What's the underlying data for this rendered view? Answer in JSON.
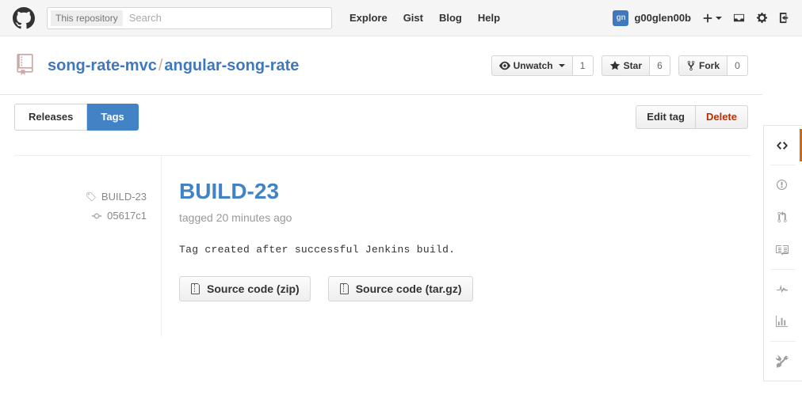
{
  "header": {
    "logo_icon": "github-mark-icon",
    "search": {
      "context_label": "This repository",
      "placeholder": "Search",
      "value": ""
    },
    "nav": [
      {
        "label": "Explore",
        "name": "explore"
      },
      {
        "label": "Gist",
        "name": "gist"
      },
      {
        "label": "Blog",
        "name": "blog"
      },
      {
        "label": "Help",
        "name": "help"
      }
    ],
    "user": {
      "username": "g00glen00b",
      "avatar_initials": "gn",
      "avatar_color": "#4078c0"
    },
    "icons": [
      {
        "name": "create-new-icon",
        "glyph": "+"
      },
      {
        "name": "inbox-icon",
        "glyph": "inbox"
      },
      {
        "name": "gear-icon",
        "glyph": "gear"
      },
      {
        "name": "sign-out-icon",
        "glyph": "sign-out"
      }
    ]
  },
  "repo": {
    "icon": "repo-book-icon",
    "owner": "song-rate-mvc",
    "separator": "/",
    "name": "angular-song-rate",
    "actions": [
      {
        "name": "unwatch",
        "icon": "eye-icon",
        "label": "Unwatch",
        "has_caret": true,
        "count": "1"
      },
      {
        "name": "star",
        "icon": "star-icon",
        "label": "Star",
        "has_caret": false,
        "count": "6"
      },
      {
        "name": "fork",
        "icon": "repo-forked-icon",
        "label": "Fork",
        "has_caret": false,
        "count": "0"
      }
    ]
  },
  "subnav": {
    "tabs": [
      {
        "label": "Releases",
        "name": "releases",
        "active": false
      },
      {
        "label": "Tags",
        "name": "tags",
        "active": true
      }
    ],
    "tag_actions": [
      {
        "label": "Edit tag",
        "name": "edit-tag",
        "danger": false
      },
      {
        "label": "Delete",
        "name": "delete-tag",
        "danger": true
      }
    ]
  },
  "release": {
    "meta": {
      "tag_icon": "tag-icon",
      "tag_name": "BUILD-23",
      "commit_icon": "git-commit-icon",
      "commit_sha": "05617c1"
    },
    "title": "BUILD-23",
    "date_text": "tagged 20 minutes ago",
    "notes": "Tag created after successful Jenkins build.",
    "downloads": [
      {
        "label": "Source code (zip)",
        "name": "download-zip",
        "icon": "file-zip-icon"
      },
      {
        "label": "Source code (tar.gz)",
        "name": "download-targz",
        "icon": "file-zip-icon"
      }
    ]
  },
  "right_rail": {
    "accent_color": "#d26911",
    "items": [
      {
        "name": "code",
        "icon": "code-icon",
        "active": true
      },
      {
        "sep": true
      },
      {
        "name": "issues",
        "icon": "issue-opened-icon",
        "active": false
      },
      {
        "name": "pull-requests",
        "icon": "git-pull-request-icon",
        "active": false
      },
      {
        "name": "wiki",
        "icon": "book-icon",
        "active": false
      },
      {
        "sep": true
      },
      {
        "name": "pulse",
        "icon": "pulse-icon",
        "active": false
      },
      {
        "name": "graphs",
        "icon": "graph-icon",
        "active": false
      },
      {
        "sep": true
      },
      {
        "name": "settings",
        "icon": "tools-icon",
        "active": false
      }
    ]
  }
}
